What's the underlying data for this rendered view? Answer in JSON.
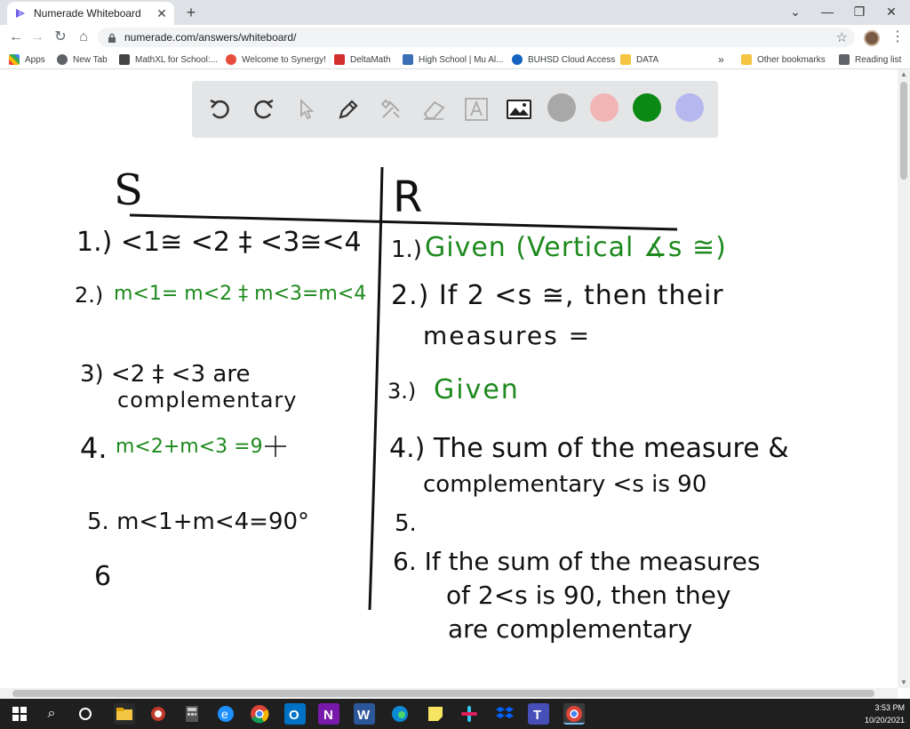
{
  "browser": {
    "tab_title": "Numerade Whiteboard",
    "tab_close": "✕",
    "new_tab": "+",
    "url": "numerade.com/answers/whiteboard/",
    "bookmarks": [
      "Apps",
      "New Tab",
      "MathXL for School:...",
      "Welcome to Synergy!",
      "DeltaMath",
      "High School | Mu Al...",
      "BUHSD Cloud Access",
      "DATA"
    ],
    "overflow": "»",
    "other_bookmarks": "Other bookmarks",
    "reading_list": "Reading list"
  },
  "toolbar": {
    "colors": {
      "gray": "#a8a8a8",
      "pink": "#f2b5b5",
      "green": "#0a8a14",
      "lavender": "#b5b8ee"
    }
  },
  "whiteboard": {
    "col_s": "S",
    "col_r": "R",
    "s1": "1.) <1≅ <2 ‡ <3≅<4",
    "s2_num": "2.)",
    "s2": "m<1= m<2 ‡ m<3=m<4",
    "s3_a": "3) <2 ‡ <3 are",
    "s3_b": "complementary",
    "s4_num": "4.",
    "s4": "m<2+m<3 =9",
    "s5": "5. m<1+m<4=90°",
    "s6": "6",
    "r1_num": "1.)",
    "r1": "Given (Vertical ∡s ≅)",
    "r2_a": "2.) If 2 <s ≅, then their",
    "r2_b": "measures =",
    "r3_num": "3.)",
    "r3": "Given",
    "r4_a": "4.) The sum of the measure &",
    "r4_b": "complementary <s is 90",
    "r5": "5.",
    "r6_a": "6. If the sum of the measures",
    "r6_b": "of 2<s is 90, then they",
    "r6_c": "are complementary"
  },
  "taskbar": {
    "time": "3:53 PM",
    "date": "10/20/2021"
  }
}
